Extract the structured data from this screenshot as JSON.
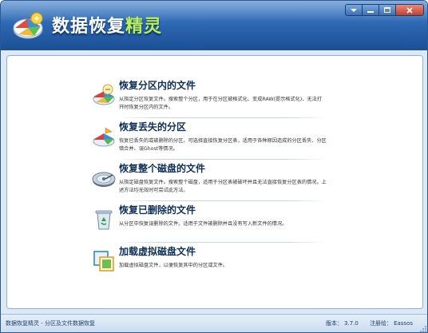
{
  "app": {
    "title_prefix": "数据恢复",
    "title_accent": "精灵"
  },
  "window_controls": {
    "minimize": "minimize-icon",
    "maximize": "maximize-icon",
    "close": "close-icon"
  },
  "menu": [
    {
      "title": "恢复分区内的文件",
      "description": "从指定分区恢复文件。搜索整个分区，用于在分区被格式化、变成RAW(提示格式化)、无法打开时恢复分区内的文件。",
      "icon": "partition-files-icon"
    },
    {
      "title": "恢复丢失的分区",
      "description": "恢复已丢失的或被删除的分区。可选择直接恢复分区表，适用于各种原因造成的分区丢失、分区错合并、误Ghost等情况。",
      "icon": "lost-partition-icon"
    },
    {
      "title": "恢复整个磁盘的文件",
      "description": "从指定磁盘恢复文件。搜索整个磁盘，适用于分区表被破坏并且无法直接恢复分区表的情况。上述方法均无效时可尝试此方法。",
      "icon": "whole-disk-icon"
    },
    {
      "title": "恢复已删除的文件",
      "description": "从分区中恢复误删除的文件。适用于文件被删除并且没有写入新文件的情况。",
      "icon": "recycle-bin-icon"
    },
    {
      "title": "加载虚拟磁盘文件",
      "description": "加载虚拟磁盘文件，以便恢复其中的分区或文件。",
      "icon": "virtual-disk-icon"
    }
  ],
  "status": {
    "left": "数据恢复精灵 - 分区及文件数据恢复",
    "version_label": "版本：",
    "version": "3.7.0",
    "reg_label": "注册给：",
    "reg_to": "Eassos"
  },
  "colors": {
    "titlebar": "#2e69b3",
    "accent_title": "#b9f05a",
    "menu_title": "#0f2f57",
    "frame": "#dde9f6"
  }
}
